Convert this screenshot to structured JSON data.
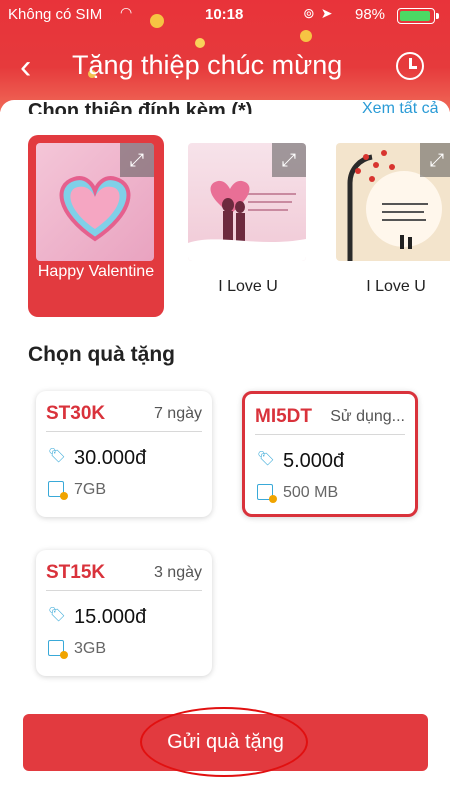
{
  "status_bar": {
    "carrier": "Không có SIM",
    "time": "10:18",
    "battery_pct": "98%",
    "battery_level": 0.98
  },
  "header": {
    "title": "Tặng thiệp chúc mừng",
    "section_partial": "Chọn thiệp đính kèm (*)",
    "see_all": "Xem tất cả"
  },
  "cards": [
    {
      "label": "Happy Valentine",
      "selected": true
    },
    {
      "label": "I Love U",
      "selected": false
    },
    {
      "label": "I Love U",
      "selected": false
    }
  ],
  "gift_section": {
    "title": "Chọn quà tặng",
    "gifts": [
      {
        "code": "ST30K",
        "duration": "7 ngày",
        "price": "30.000đ",
        "data": "7GB",
        "selected": false
      },
      {
        "code": "MI5DT",
        "duration": "Sử dụng...",
        "price": "5.000đ",
        "data": "500 MB",
        "selected": true
      },
      {
        "code": "ST15K",
        "duration": "3 ngày",
        "price": "15.000đ",
        "data": "3GB",
        "selected": false
      }
    ]
  },
  "send_button": {
    "label": "Gửi quà tặng"
  },
  "colors": {
    "accent": "#e23a3f",
    "price_icon": "#39a9d8"
  }
}
